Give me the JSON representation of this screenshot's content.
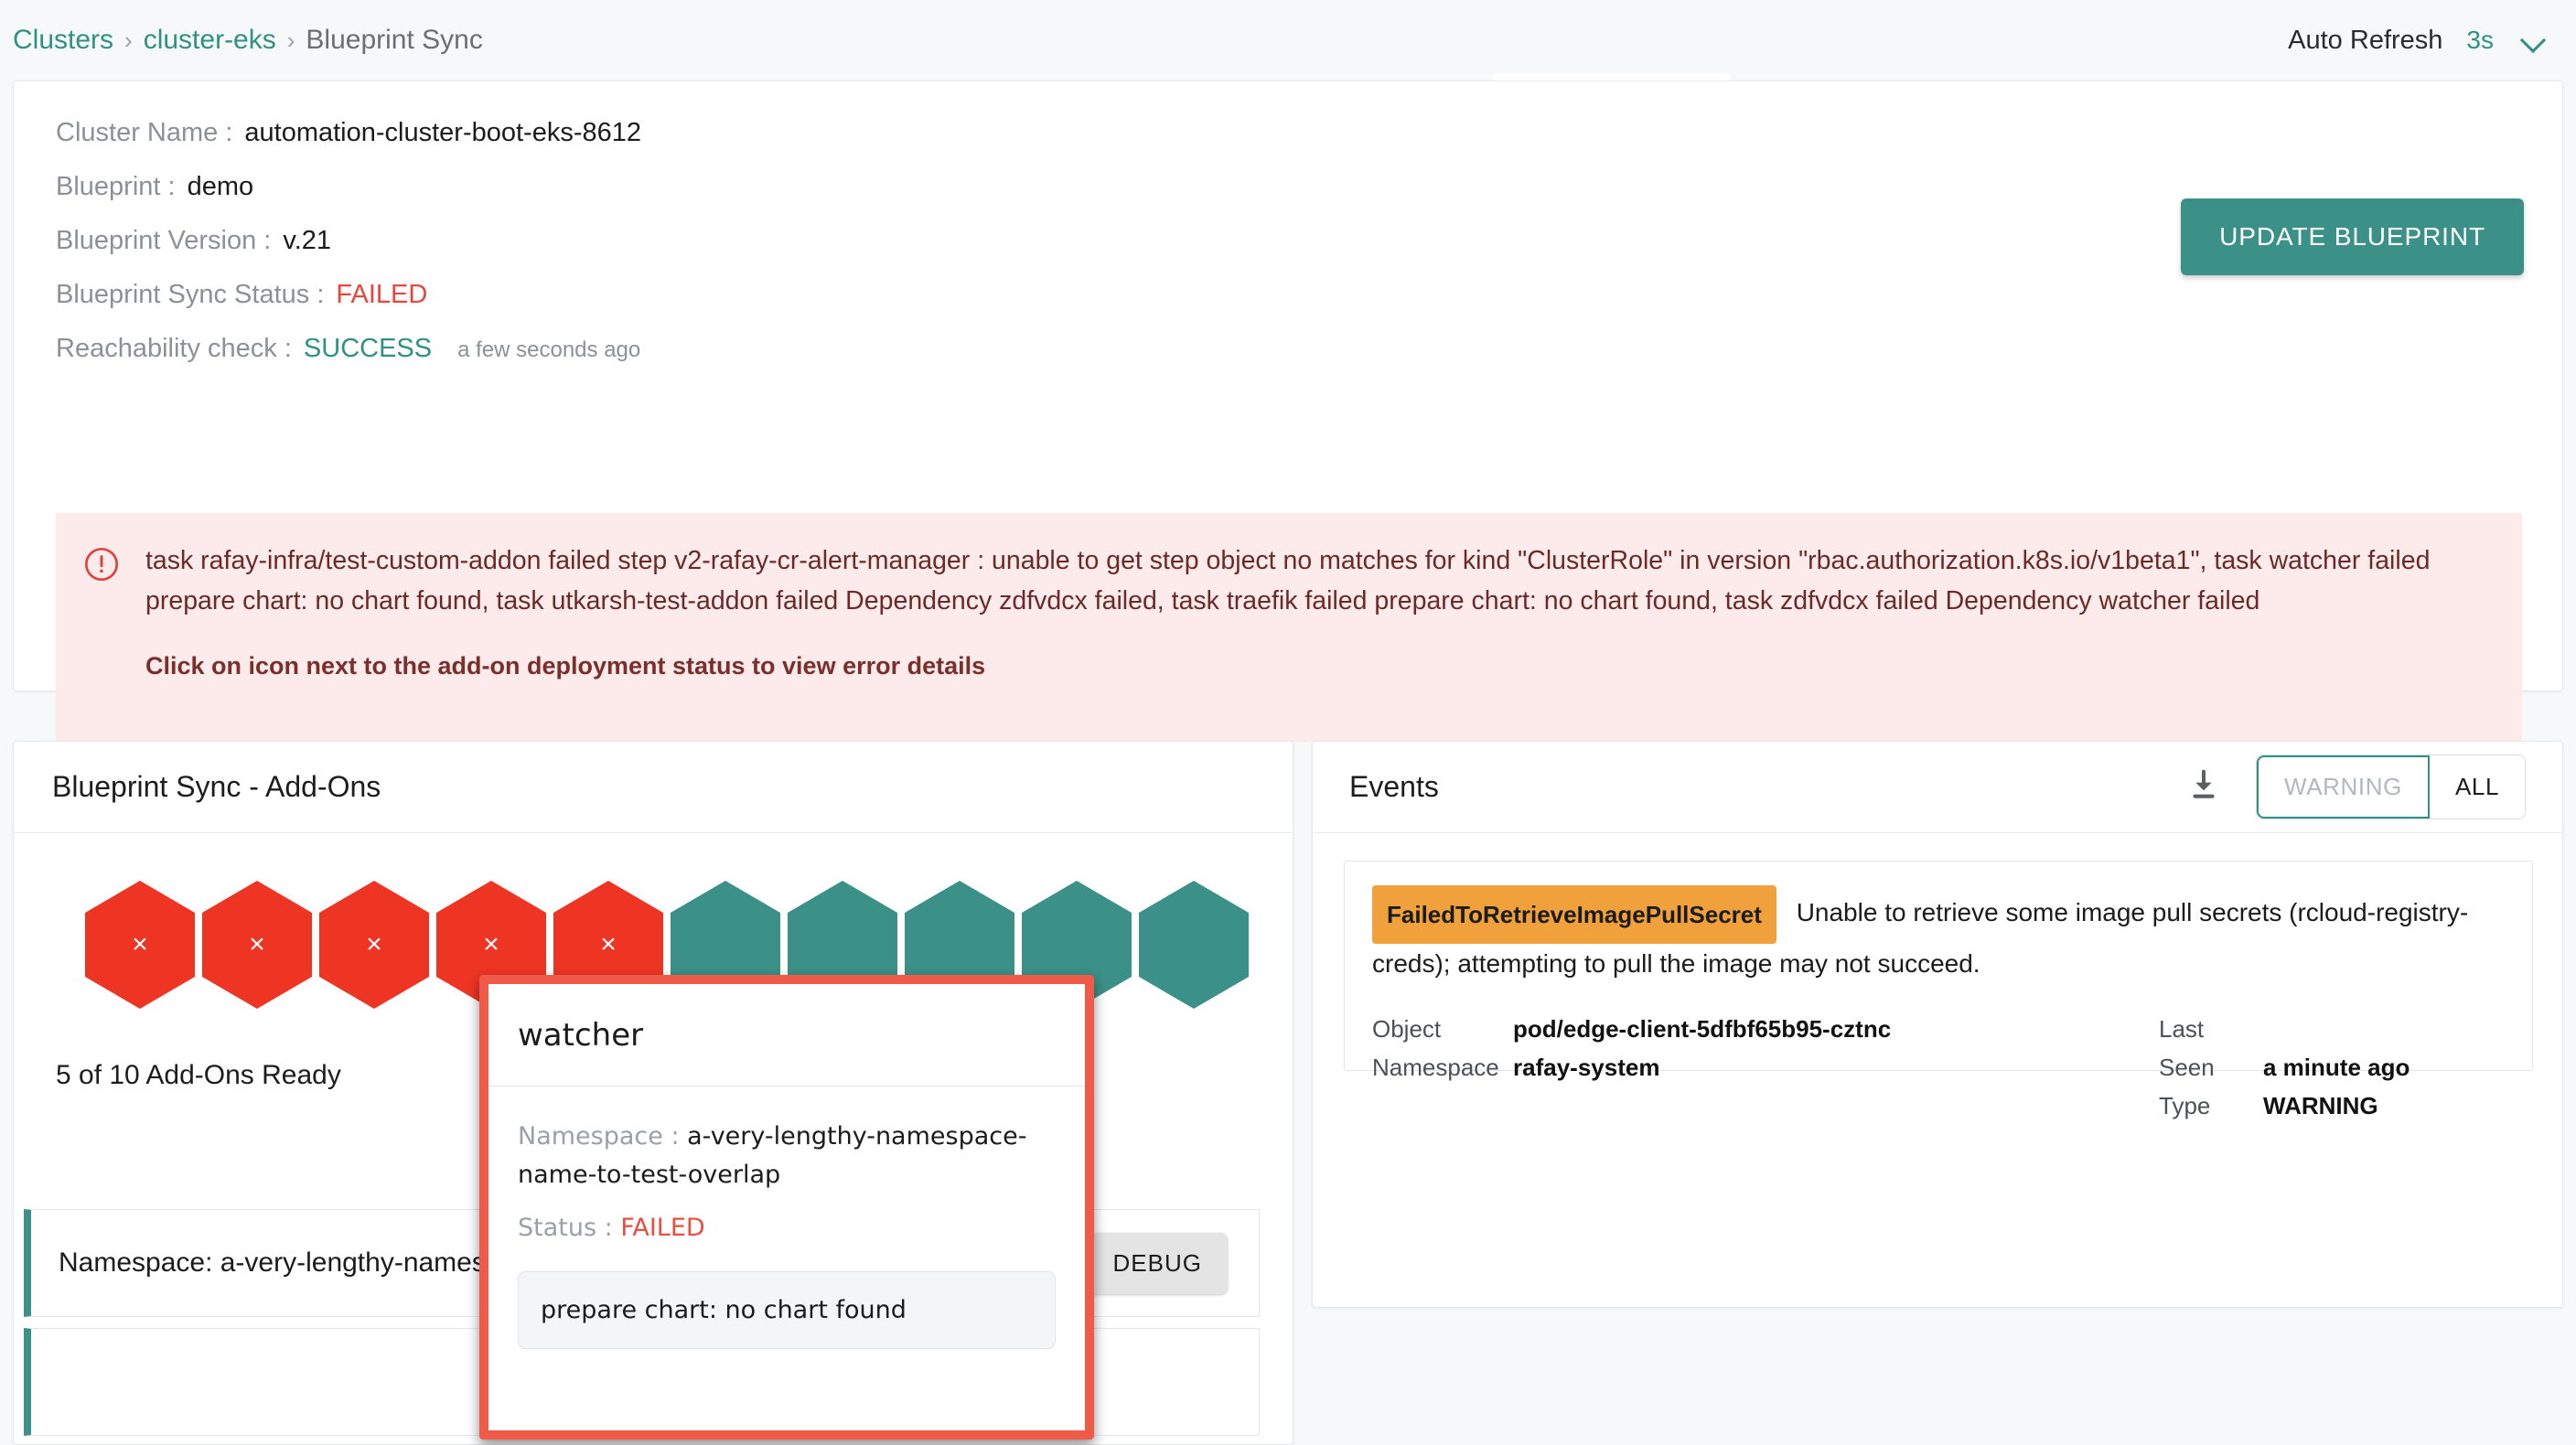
{
  "breadcrumb": {
    "items": [
      {
        "label": "Clusters",
        "type": "link"
      },
      {
        "label": "cluster-eks",
        "type": "link"
      },
      {
        "label": "Blueprint Sync",
        "type": "current"
      }
    ],
    "separator": "›"
  },
  "header": {
    "auto_refresh_label": "Auto Refresh",
    "auto_refresh_value": "3s",
    "chevron_icon": "chevron-down-icon"
  },
  "summary": {
    "fields": [
      {
        "key": "Cluster Name :",
        "value": "automation-cluster-boot-eks-8612",
        "state": "normal"
      },
      {
        "key": "Blueprint :",
        "value": "demo",
        "state": "normal"
      },
      {
        "key": "Blueprint Version :",
        "value": "v.21",
        "state": "normal"
      },
      {
        "key": "Blueprint Sync Status :",
        "value": "FAILED",
        "state": "failed"
      },
      {
        "key": "Reachability check :",
        "value": "SUCCESS",
        "state": "success",
        "sub": "a few seconds ago"
      }
    ],
    "update_button": "UPDATE BLUEPRINT"
  },
  "error_banner": {
    "icon": "alert-circle-icon",
    "message": "task rafay-infra/test-custom-addon failed step v2-rafay-cr-alert-manager : unable to get step object no matches for kind \"ClusterRole\" in version \"rbac.authorization.k8s.io/v1beta1\", task watcher failed prepare chart: no chart found, task utkarsh-test-addon failed Dependency zdfvdcx failed, task traefik failed prepare chart: no chart found, task zdfvdcx failed Dependency watcher failed",
    "hint": "Click on icon next to the add-on deployment status to view error details"
  },
  "addons": {
    "title": "Blueprint Sync - Add-Ons",
    "ready_text": "5 of 10 Add-Ons Ready",
    "hexagons": [
      {
        "status": "failed",
        "glyph": "×"
      },
      {
        "status": "failed",
        "glyph": "×"
      },
      {
        "status": "failed",
        "glyph": "×"
      },
      {
        "status": "failed",
        "glyph": "×"
      },
      {
        "status": "failed",
        "glyph": "×"
      },
      {
        "status": "ok",
        "glyph": ""
      },
      {
        "status": "ok",
        "glyph": ""
      },
      {
        "status": "ok",
        "glyph": ""
      },
      {
        "status": "ok",
        "glyph": ""
      },
      {
        "status": "ok",
        "glyph": ""
      }
    ],
    "rows": [
      {
        "namespace_text": "Namespace: a-very-lengthy-namespace-name-to-test-overlap",
        "debug_label": "DEBUG"
      },
      {
        "namespace_text": "",
        "debug_label": ""
      }
    ]
  },
  "events": {
    "title": "Events",
    "download_icon": "download-icon",
    "filters": [
      {
        "label": "WARNING",
        "selected": true
      },
      {
        "label": "ALL",
        "selected": false
      }
    ],
    "items": [
      {
        "badge": "FailedToRetrieveImagePullSecret",
        "message": "Unable to retrieve some image pull secrets (rcloud-registry-creds); attempting to pull the image may not succeed.",
        "object_label": "Object",
        "object_value": "pod/edge-client-5dfbf65b95-cztnc",
        "namespace_label": "Namespace",
        "namespace_value": "rafay-system",
        "last_seen_label": "Last Seen",
        "last_seen_value": "a minute ago",
        "type_label": "Type",
        "type_value": "WARNING"
      }
    ]
  },
  "tooltip": {
    "title": "watcher",
    "namespace_key": "Namespace :",
    "namespace_value": "a-very-lengthy-namespace-name-to-test-overlap",
    "status_key": "Status :",
    "status_value": "FAILED",
    "message": "prepare chart: no chart found"
  },
  "colors": {
    "brand": "#3b9187",
    "failed": "#e8453c",
    "hex_failed": "#ee3524",
    "hex_ok": "#3b9187",
    "warning_badge": "#f0a13c",
    "banner_bg": "#fcebea",
    "tooltip_border": "#ef5b48"
  }
}
